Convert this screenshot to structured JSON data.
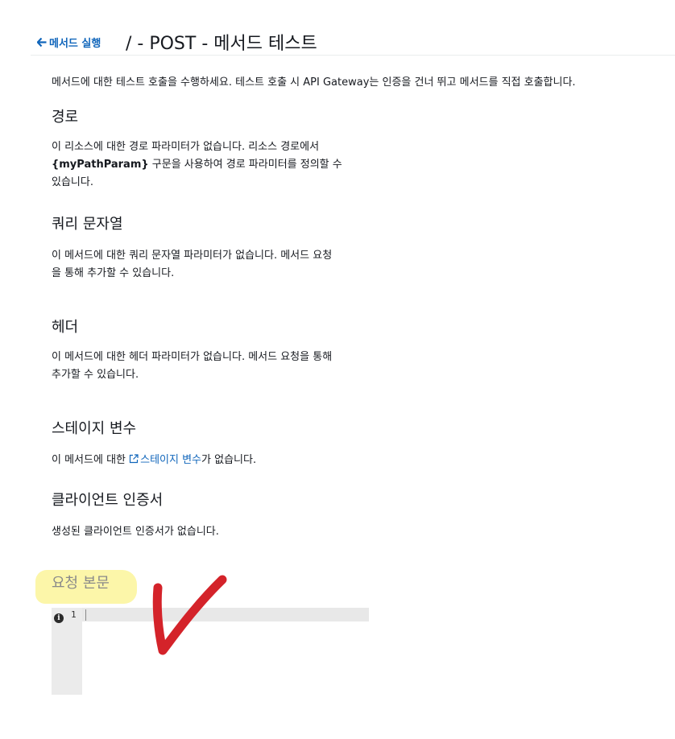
{
  "header": {
    "back_label": "메서드 실행",
    "title": "/ - POST - 메서드 테스트"
  },
  "intro": "메서드에 대한 테스트 호출을 수행하세요. 테스트 호출 시 API Gateway는 인증을 건너 뛰고 메서드를 직접 호출합니다.",
  "sections": {
    "path": {
      "title": "경로",
      "text_1": "이 리소스에 대한 경로 파라미터가 없습니다. 리소스 경로에서",
      "param_token": "{myPathParam}",
      "text_2": " 구문을 사용하여 경로 파라미터를 정의할 수",
      "text_3": "있습니다."
    },
    "query": {
      "title": "쿼리 문자열",
      "line_1": "이 메서드에 대한 쿼리 문자열 파라미터가 없습니다. 메서드 요청",
      "line_2": "을 통해 추가할 수 있습니다."
    },
    "headers": {
      "title": "헤더",
      "line_1": "이 메서드에 대한 헤더 파라미터가 없습니다. 메서드 요청을 통해",
      "line_2": "추가할 수 있습니다."
    },
    "stage": {
      "title": "스테이지 변수",
      "prefix": "이 메서드에 대한 ",
      "link": "스테이지 변수",
      "suffix": "가 없습니다."
    },
    "cert": {
      "title": "클라이언트 인증서",
      "text": "생성된 클라이언트 인증서가 없습니다."
    },
    "body": {
      "title": "요청 본문",
      "line_number": "1",
      "info_glyph": "i"
    }
  },
  "icons": {
    "back": "arrow-left-icon",
    "external": "external-link-icon",
    "info": "info-icon"
  },
  "colors": {
    "link": "#1166bb",
    "highlight": "#fbf59a",
    "annotation": "#d4232a"
  }
}
